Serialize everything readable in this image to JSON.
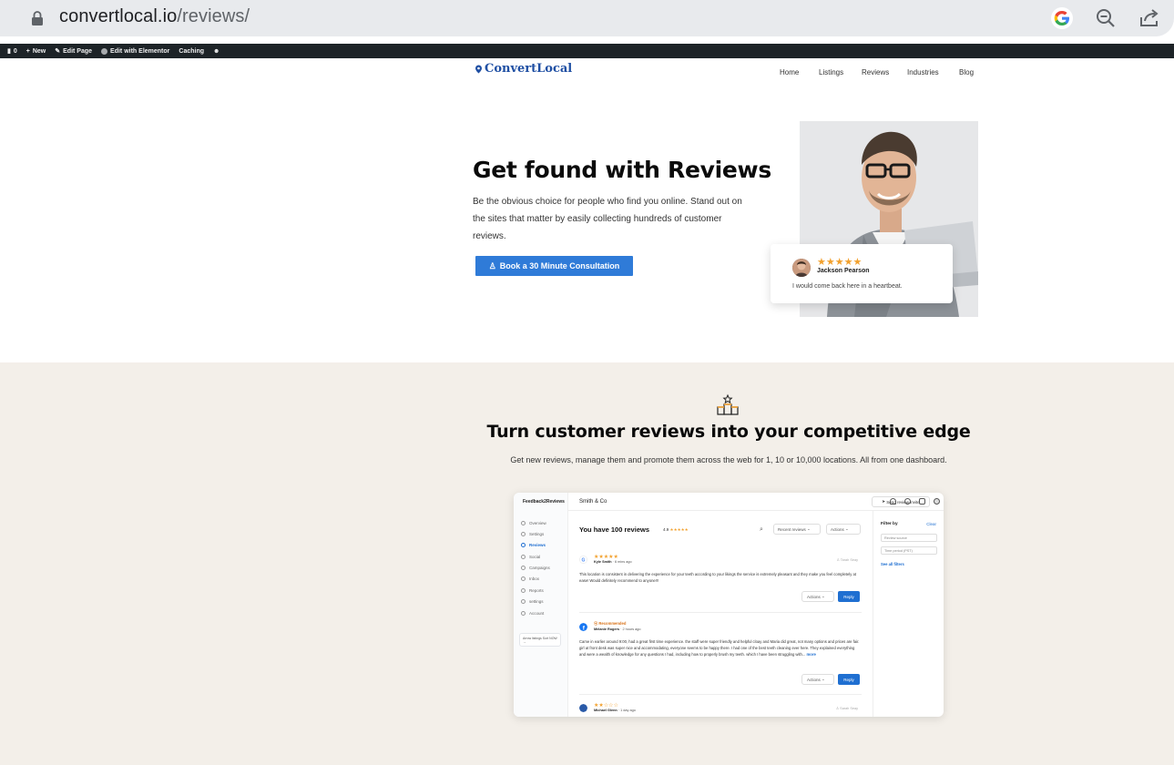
{
  "browser": {
    "url_host": "convertlocal.io",
    "url_path": "/reviews/"
  },
  "wp_admin_bar": {
    "comments_count": "0",
    "new_label": "New",
    "edit_page_label": "Edit Page",
    "elementor_label": "Edit with Elementor",
    "caching_label": "Caching"
  },
  "site": {
    "logo_text": "ConvertLocal",
    "nav": [
      "Home",
      "Listings",
      "Reviews",
      "Industries",
      "Blog"
    ]
  },
  "hero": {
    "title": "Get found with Reviews",
    "description": "Be the obvious choice for people who find you online. Stand out on the sites that matter by easily collecting hundreds of customer reviews.",
    "cta_label": "Book a 30 Minute Consultation",
    "review_card": {
      "stars": "★★★★★",
      "name": "Jackson Pearson",
      "text": "I would come back here in a heartbeat."
    }
  },
  "lower": {
    "title": "Turn customer reviews into your competitive edge",
    "subtitle": "Get new reviews, manage them and promote them across the web for 1, 10 or 10,000 locations. All from one dashboard."
  },
  "dashboard": {
    "brand": "Feedback2Reviews",
    "company": "Smith & Co",
    "invite_label": "Send review invite",
    "sidebar": [
      "Overview",
      "Settings",
      "Reviews",
      "Social",
      "Campaigns",
      "Inbox",
      "Reports",
      "settings",
      "Account"
    ],
    "promo_text": "Arrow listings Sort NOW",
    "heading": "You have 100 reviews",
    "rating": "4.9",
    "rating_stars": "★★★★★",
    "sort_label": "Recent reviews",
    "actions_label": "Actions",
    "reply_label": "Reply",
    "reviews": [
      {
        "stars": "★★★★★",
        "name": "Kyle Smith",
        "time": "· 6 mins ago",
        "tag": "Tarah Seay",
        "body": "This location is consistent in delivering the experience for your teeth according to your likings the service is extremely pleasant and they make you feel completely at ease! Would definitely recommend to anyone!!!"
      },
      {
        "badge": "Recommended",
        "name": "Melanie Rogers",
        "time": "· 2 hours ago",
        "body": "Came in earlier around 9:00, had a great first time experience. the staff were super friendly and helpful cloay and Maria did great, not many options and prices are fair. girl at front desk was super nice and accommodating, everyone seems to be happy there. I had one of the best teeth cleaning ever here. They explained everything and were a wealth of knowledge for any questions I had, including how to properly brush my teeth. which I have been struggling with...",
        "more": "more"
      },
      {
        "stars": "★★☆☆☆",
        "name": "Michael Glenn",
        "time": "· 1 day ago",
        "tag": "Sarah Seay"
      }
    ],
    "filter_title": "Filter by",
    "filter_clear": "Clear",
    "filter_source": "Review source",
    "filter_period": "Time period (PST)",
    "filter_link": "See all filters"
  }
}
